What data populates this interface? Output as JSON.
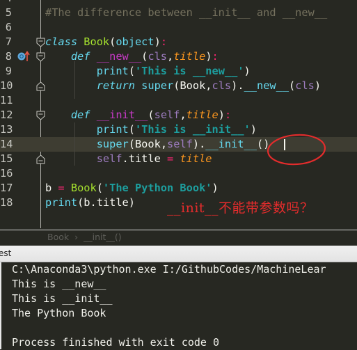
{
  "editor": {
    "lines": [
      {
        "num": "4",
        "tokens": []
      },
      {
        "num": "5",
        "tokens": [
          {
            "t": "#The difference between __init__ and __new__",
            "c": "c-comment"
          }
        ]
      },
      {
        "num": "6",
        "tokens": []
      },
      {
        "num": "7",
        "tokens": [
          {
            "t": "class",
            "c": "c-kw"
          },
          {
            "t": " ",
            "c": "c-plain"
          },
          {
            "t": "Book",
            "c": "c-cls"
          },
          {
            "t": "(",
            "c": "c-plain"
          },
          {
            "t": "object",
            "c": "c-builtin"
          },
          {
            "t": ")",
            "c": "c-plain"
          },
          {
            "t": ":",
            "c": "c-op"
          }
        ]
      },
      {
        "num": "8",
        "tokens": [
          {
            "t": "    ",
            "c": "c-plain"
          },
          {
            "t": "def",
            "c": "c-kw"
          },
          {
            "t": " ",
            "c": "c-plain"
          },
          {
            "t": "__new__",
            "c": "c-magic2"
          },
          {
            "t": "(",
            "c": "c-plain"
          },
          {
            "t": "cls",
            "c": "c-self"
          },
          {
            "t": ",",
            "c": "c-plain"
          },
          {
            "t": "title",
            "c": "c-param"
          },
          {
            "t": ")",
            "c": "c-plain"
          },
          {
            "t": ":",
            "c": "c-op"
          }
        ]
      },
      {
        "num": "9",
        "tokens": [
          {
            "t": "        ",
            "c": "c-plain"
          },
          {
            "t": "print",
            "c": "c-call"
          },
          {
            "t": "(",
            "c": "c-plain"
          },
          {
            "t": "'This is __new__'",
            "c": "c-str"
          },
          {
            "t": ")",
            "c": "c-plain"
          }
        ]
      },
      {
        "num": "10",
        "tokens": [
          {
            "t": "        ",
            "c": "c-plain"
          },
          {
            "t": "return",
            "c": "c-kw"
          },
          {
            "t": " ",
            "c": "c-plain"
          },
          {
            "t": "super",
            "c": "c-call"
          },
          {
            "t": "(",
            "c": "c-plain"
          },
          {
            "t": "Book",
            "c": "c-plain"
          },
          {
            "t": ",",
            "c": "c-plain"
          },
          {
            "t": "cls",
            "c": "c-self"
          },
          {
            "t": ").",
            "c": "c-plain"
          },
          {
            "t": "__new__",
            "c": "c-call"
          },
          {
            "t": "(",
            "c": "c-plain"
          },
          {
            "t": "cls",
            "c": "c-self"
          },
          {
            "t": ")",
            "c": "c-plain"
          }
        ]
      },
      {
        "num": "11",
        "tokens": []
      },
      {
        "num": "12",
        "tokens": [
          {
            "t": "    ",
            "c": "c-plain"
          },
          {
            "t": "def",
            "c": "c-kw"
          },
          {
            "t": " ",
            "c": "c-plain"
          },
          {
            "t": "__init__",
            "c": "c-magic2"
          },
          {
            "t": "(",
            "c": "c-plain"
          },
          {
            "t": "self",
            "c": "c-self"
          },
          {
            "t": ",",
            "c": "c-plain"
          },
          {
            "t": "title",
            "c": "c-param"
          },
          {
            "t": ")",
            "c": "c-plain"
          },
          {
            "t": ":",
            "c": "c-op"
          }
        ]
      },
      {
        "num": "13",
        "tokens": [
          {
            "t": "        ",
            "c": "c-plain"
          },
          {
            "t": "print",
            "c": "c-call"
          },
          {
            "t": "(",
            "c": "c-plain"
          },
          {
            "t": "'This is __init__'",
            "c": "c-str"
          },
          {
            "t": ")",
            "c": "c-plain"
          }
        ]
      },
      {
        "num": "14",
        "current": true,
        "tokens": [
          {
            "t": "        ",
            "c": "c-plain"
          },
          {
            "t": "super",
            "c": "c-call"
          },
          {
            "t": "(",
            "c": "c-plain"
          },
          {
            "t": "Book",
            "c": "c-plain"
          },
          {
            "t": ",",
            "c": "c-plain"
          },
          {
            "t": "self",
            "c": "c-self"
          },
          {
            "t": ").",
            "c": "c-plain"
          },
          {
            "t": "__init__",
            "c": "c-call"
          },
          {
            "t": "()",
            "c": "c-plain"
          }
        ]
      },
      {
        "num": "15",
        "tokens": [
          {
            "t": "        ",
            "c": "c-plain"
          },
          {
            "t": "self",
            "c": "c-self"
          },
          {
            "t": ".title ",
            "c": "c-plain"
          },
          {
            "t": "=",
            "c": "c-op"
          },
          {
            "t": " ",
            "c": "c-plain"
          },
          {
            "t": "title",
            "c": "c-param"
          }
        ]
      },
      {
        "num": "16",
        "tokens": []
      },
      {
        "num": "17",
        "tokens": [
          {
            "t": "b ",
            "c": "c-plain"
          },
          {
            "t": "=",
            "c": "c-op"
          },
          {
            "t": " ",
            "c": "c-plain"
          },
          {
            "t": "Book",
            "c": "c-cls"
          },
          {
            "t": "(",
            "c": "c-plain"
          },
          {
            "t": "'The Python Book'",
            "c": "c-str"
          },
          {
            "t": ")",
            "c": "c-plain"
          }
        ]
      },
      {
        "num": "18",
        "tokens": [
          {
            "t": "print",
            "c": "c-call"
          },
          {
            "t": "(b.title)",
            "c": "c-plain"
          }
        ]
      }
    ],
    "annotation": "__init__不能带参数吗？",
    "gutter_icon": "override-method-icon"
  },
  "breadcrumb": {
    "items": [
      "Book",
      "__init__()"
    ],
    "separator": "›"
  },
  "run_panel": {
    "tab_label": "est",
    "output": [
      "C:\\Anaconda3\\python.exe I:/GithubCodes/MachineLear",
      "This is __new__",
      "This is __init__",
      "The Python Book",
      "",
      "Process finished with exit code 0"
    ]
  },
  "colors": {
    "editor_bg": "#272822",
    "current_line": "#3e3d32",
    "annotation_red": "#e32c2c"
  }
}
